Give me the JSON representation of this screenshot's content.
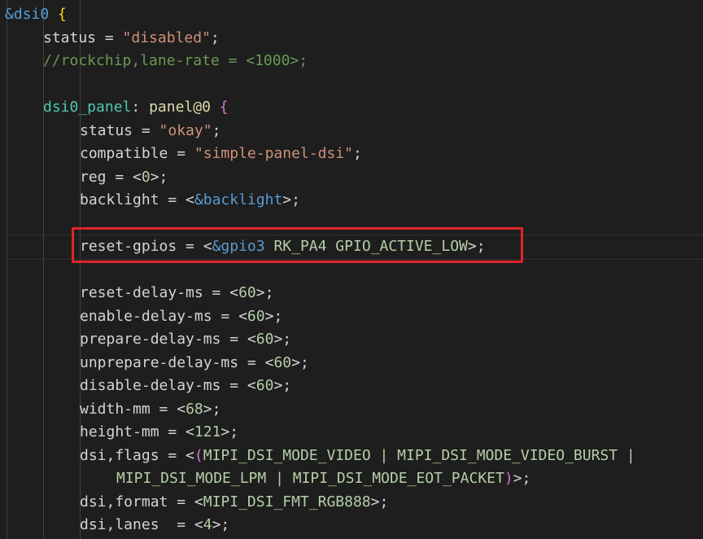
{
  "code": {
    "node_ref": "&dsi0",
    "brace_open": "{",
    "status1_prop": "status",
    "status1_value": "\"disabled\"",
    "comment": "//rockchip,lane-rate = <1000>;",
    "panel_label": "dsi0_panel",
    "panel_node": "panel@0",
    "status2_prop": "status",
    "status2_value": "\"okay\"",
    "compatible_prop": "compatible",
    "compatible_value": "\"simple-panel-dsi\"",
    "reg_prop": "reg",
    "reg_value": "0",
    "backlight_prop": "backlight",
    "backlight_value": "&backlight",
    "reset_gpios_prop": "reset-gpios",
    "reset_gpios_ref": "&gpio3",
    "reset_gpios_args": "RK_PA4 GPIO_ACTIVE_LOW",
    "reset_delay_prop": "reset-delay-ms",
    "reset_delay_value": "60",
    "enable_delay_prop": "enable-delay-ms",
    "enable_delay_value": "60",
    "prepare_delay_prop": "prepare-delay-ms",
    "prepare_delay_value": "60",
    "unprepare_delay_prop": "unprepare-delay-ms",
    "unprepare_delay_value": "60",
    "disable_delay_prop": "disable-delay-ms",
    "disable_delay_value": "60",
    "width_prop": "width-mm",
    "width_value": "68",
    "height_prop": "height-mm",
    "height_value": "121",
    "flags_prop": "dsi,flags",
    "flags_part1": "MIPI_DSI_MODE_VIDEO | MIPI_DSI_MODE_VIDEO_BURST |",
    "flags_part2": "MIPI_DSI_MODE_LPM | MIPI_DSI_MODE_EOT_PACKET",
    "format_prop": "dsi,format",
    "format_value": "MIPI_DSI_FMT_RGB888",
    "lanes_prop": "dsi,lanes ",
    "lanes_value": "4"
  },
  "colors": {
    "background": "#1e1e1e",
    "highlight_box": "#e0242b"
  }
}
